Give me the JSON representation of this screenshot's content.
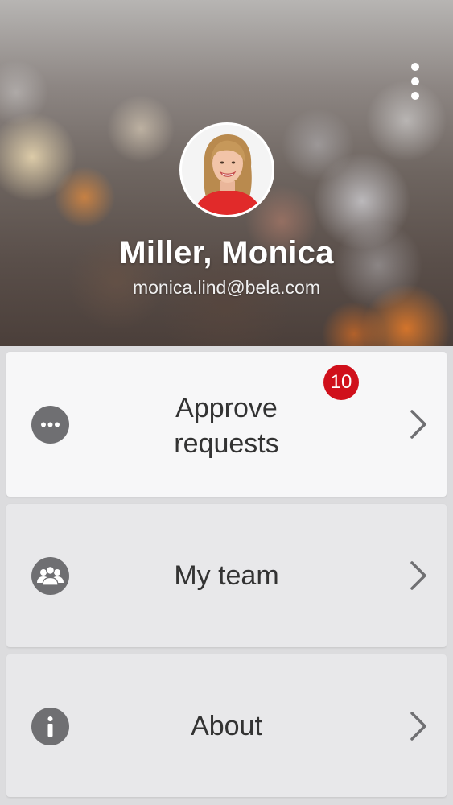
{
  "header": {
    "menu_icon": "more-vertical-icon",
    "user": {
      "name": "Miller, Monica",
      "email": "monica.lind@bela.com"
    }
  },
  "menu": {
    "items": [
      {
        "icon": "more-horizontal-icon",
        "label_line1": "Approve",
        "label_line2": "requests",
        "badge": "10",
        "chevron": "chevron-right-icon"
      },
      {
        "icon": "team-icon",
        "label": "My team",
        "chevron": "chevron-right-icon"
      },
      {
        "icon": "info-icon",
        "label": "About",
        "chevron": "chevron-right-icon"
      }
    ]
  },
  "colors": {
    "badge": "#d0101b",
    "icon_circle": "#6f6f72",
    "text": "#333333",
    "card_active": "#f7f7f8",
    "card_inactive": "#e8e8ea"
  }
}
